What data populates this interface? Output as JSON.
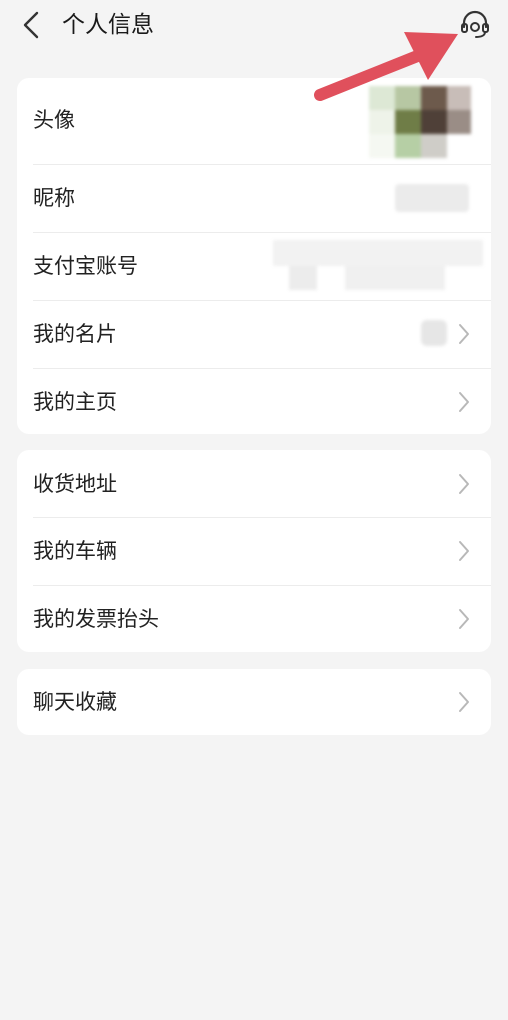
{
  "header": {
    "title": "个人信息",
    "back_icon": "chevron-left-icon",
    "service_icon": "customer-service-headset-icon"
  },
  "groups": [
    {
      "items": [
        {
          "label": "头像",
          "icon": "chevron-right-icon"
        },
        {
          "label": "昵称",
          "icon": "chevron-right-icon"
        },
        {
          "label": "支付宝账号",
          "icon": "chevron-right-icon"
        },
        {
          "label": "我的名片",
          "icon": "chevron-right-icon"
        },
        {
          "label": "我的主页",
          "icon": "chevron-right-icon"
        }
      ]
    },
    {
      "items": [
        {
          "label": "收货地址",
          "icon": "chevron-right-icon"
        },
        {
          "label": "我的车辆",
          "icon": "chevron-right-icon"
        },
        {
          "label": "我的发票抬头",
          "icon": "chevron-right-icon"
        }
      ]
    },
    {
      "items": [
        {
          "label": "聊天收藏",
          "icon": "chevron-right-icon"
        }
      ]
    }
  ],
  "colors": {
    "background": "#f4f4f4",
    "card": "#ffffff",
    "annotation_arrow": "#e0505c"
  }
}
